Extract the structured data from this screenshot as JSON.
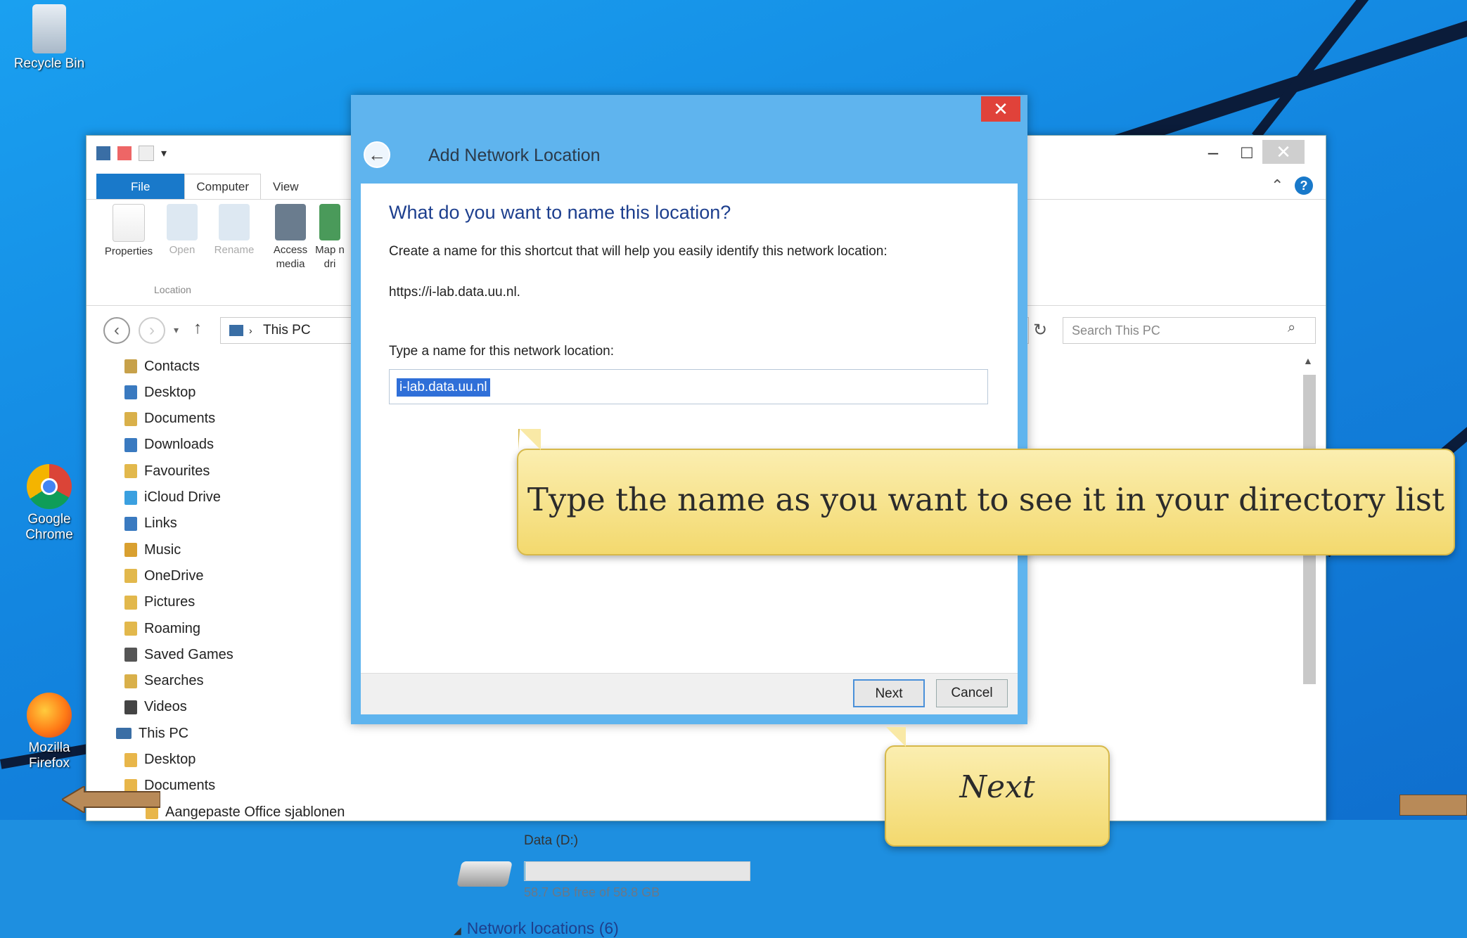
{
  "desktop": {
    "icons": [
      {
        "label": "Recycle Bin"
      },
      {
        "label": "Google Chrome"
      },
      {
        "label": "Mozilla Firefox"
      }
    ]
  },
  "explorer": {
    "tabs": [
      "File",
      "Computer",
      "View"
    ],
    "ribbon": {
      "buttons": [
        "Properties",
        "Open",
        "Rename",
        "Access media",
        "Map n dri"
      ],
      "group_label": "Location"
    },
    "address": {
      "path": "This PC"
    },
    "search_placeholder": "Search This PC",
    "nav_items": [
      "Contacts",
      "Desktop",
      "Documents",
      "Downloads",
      "Favourites",
      "iCloud Drive",
      "Links",
      "Music",
      "OneDrive",
      "Pictures",
      "Roaming",
      "Saved Games",
      "Searches",
      "Videos"
    ],
    "this_pc": "This PC",
    "this_pc_items": [
      "Desktop",
      "Documents",
      "Aangepaste Office sjablonen"
    ],
    "drive": {
      "name": "Data (D:)",
      "free": "58.7 GB free of 58.8 GB",
      "used_fraction": 0.002
    },
    "network_locations": "Network locations (6)"
  },
  "dialog": {
    "title": "Add Network Location",
    "heading": "What do you want to name this location?",
    "description": "Create a name for this shortcut that will help you easily identify this network location:",
    "url": "https://i-lab.data.uu.nl.",
    "input_label": "Type a name for this network location:",
    "input_value": "i-lab.data.uu.nl",
    "next_label": "Next",
    "cancel_label": "Cancel",
    "close_glyph": "✕",
    "back_glyph": "←"
  },
  "callouts": {
    "main": "Type the name as you want to see it in your directory list",
    "next": "Next"
  }
}
